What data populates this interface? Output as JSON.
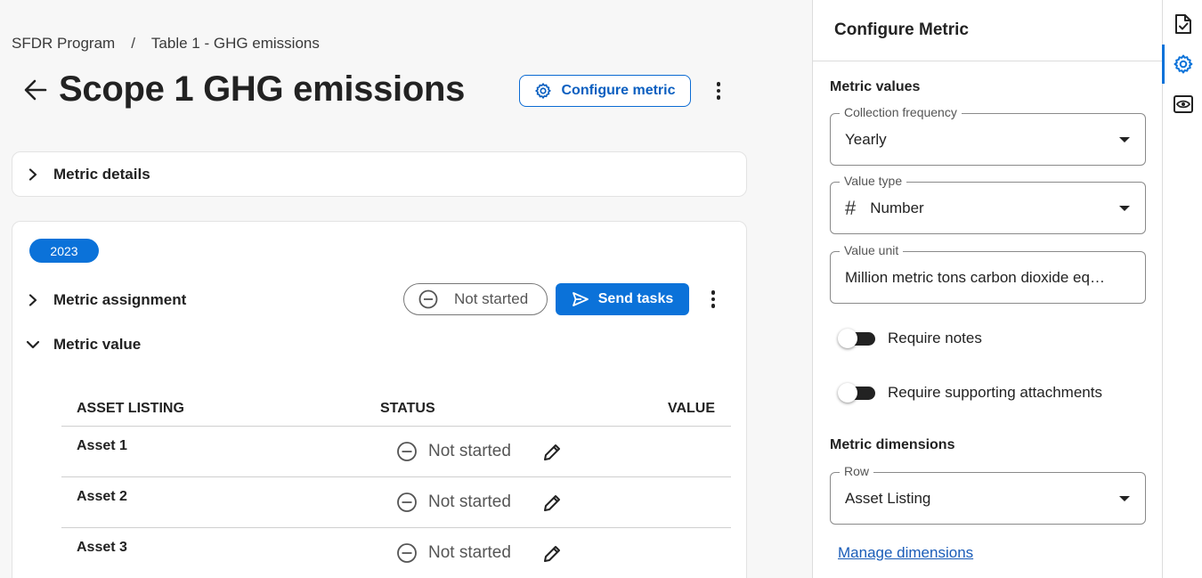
{
  "breadcrumb": {
    "program": "SFDR Program",
    "separator": "/",
    "table": "Table 1 - GHG emissions"
  },
  "header": {
    "title": "Scope 1 GHG emissions",
    "configure_label": "Configure metric"
  },
  "details": {
    "label": "Metric details"
  },
  "card": {
    "year": "2023",
    "assignment_label": "Metric assignment",
    "assignment_status": "Not started",
    "send_label": "Send tasks",
    "value_label": "Metric value"
  },
  "table": {
    "columns": [
      "ASSET LISTING",
      "STATUS",
      "VALUE"
    ],
    "rows": [
      {
        "asset": "Asset 1",
        "status": "Not started",
        "value": ""
      },
      {
        "asset": "Asset 2",
        "status": "Not started",
        "value": ""
      },
      {
        "asset": "Asset 3",
        "status": "Not started",
        "value": ""
      }
    ]
  },
  "panel": {
    "title": "Configure Metric",
    "metric_values_heading": "Metric values",
    "collection_frequency": {
      "label": "Collection frequency",
      "value": "Yearly"
    },
    "value_type": {
      "label": "Value type",
      "icon": "#",
      "value": "Number"
    },
    "value_unit": {
      "label": "Value unit",
      "value": "Million metric tons carbon dioxide eq…"
    },
    "require_notes": {
      "label": "Require notes",
      "on": false
    },
    "require_attachments": {
      "label": "Require supporting attachments",
      "on": false
    },
    "dimensions_heading": "Metric dimensions",
    "row": {
      "label": "Row",
      "value": "Asset Listing"
    },
    "manage_link": "Manage dimensions"
  },
  "rail": {
    "items": [
      "document-check-icon",
      "gear-icon",
      "eye-icon"
    ],
    "active": "gear-icon"
  },
  "colors": {
    "accent": "#0b72d9",
    "text": "#1f1f1f",
    "background": "#f7f7f7"
  }
}
